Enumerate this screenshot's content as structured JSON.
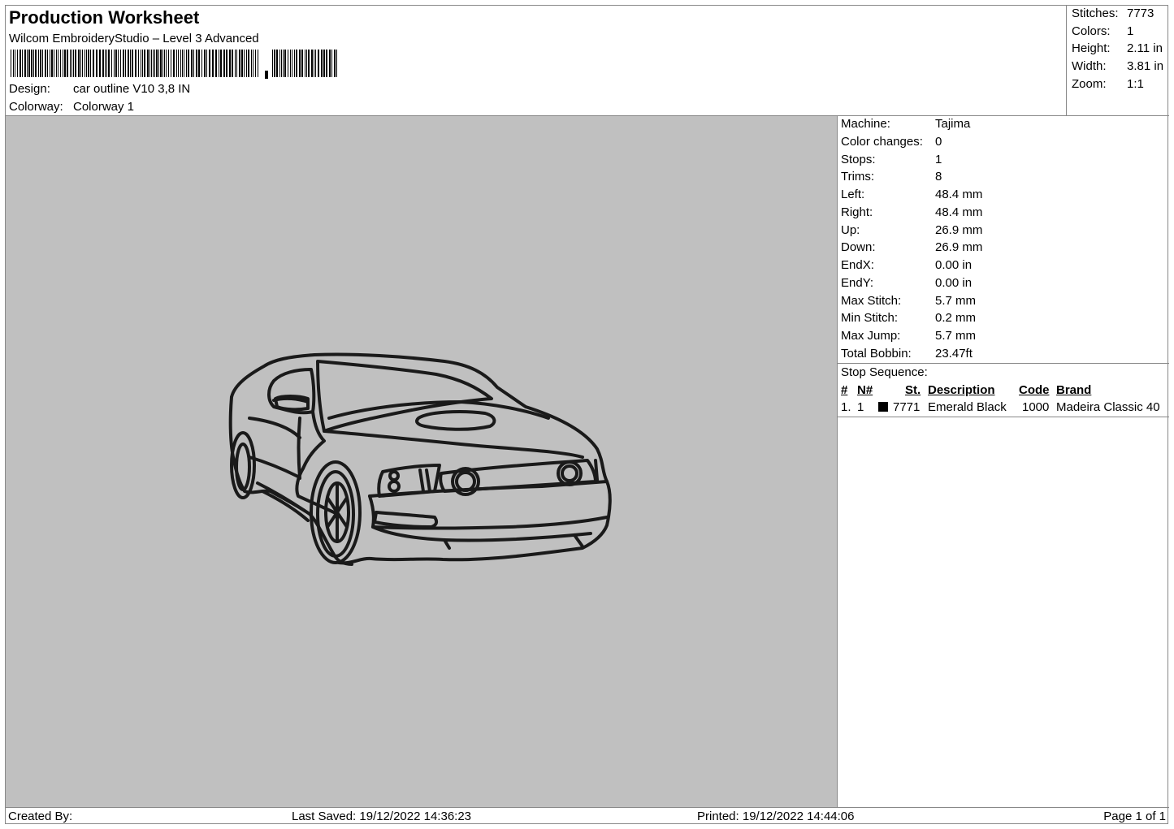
{
  "header": {
    "title": "Production Worksheet",
    "software": "Wilcom EmbroideryStudio – Level 3 Advanced",
    "design_label": "Design:",
    "design_value": "car outline V10 3,8 IN",
    "colorway_label": "Colorway:",
    "colorway_value": "Colorway 1"
  },
  "stats": {
    "stitches_label": "Stitches:",
    "stitches_value": "7773",
    "colors_label": "Colors:",
    "colors_value": "1",
    "height_label": "Height:",
    "height_value": "2.11 in",
    "width_label": "Width:",
    "width_value": "3.81 in",
    "zoom_label": "Zoom:",
    "zoom_value": "1:1"
  },
  "machine_info": [
    {
      "label": "Machine:",
      "value": "Tajima"
    },
    {
      "label": "Color changes:",
      "value": "0"
    },
    {
      "label": "Stops:",
      "value": "1"
    },
    {
      "label": "Trims:",
      "value": "8"
    },
    {
      "label": "Left:",
      "value": "48.4 mm"
    },
    {
      "label": "Right:",
      "value": "48.4 mm"
    },
    {
      "label": "Up:",
      "value": "26.9 mm"
    },
    {
      "label": "Down:",
      "value": "26.9 mm"
    },
    {
      "label": "EndX:",
      "value": "0.00 in"
    },
    {
      "label": "EndY:",
      "value": "0.00 in"
    },
    {
      "label": "Max Stitch:",
      "value": "5.7 mm"
    },
    {
      "label": "Min Stitch:",
      "value": "0.2 mm"
    },
    {
      "label": "Max Jump:",
      "value": "5.7 mm"
    },
    {
      "label": "Total Bobbin:",
      "value": "23.47ft"
    }
  ],
  "stop_sequence": {
    "caption": "Stop Sequence:",
    "headers": {
      "num": "#",
      "n": "N#",
      "st": "St.",
      "description": "Description",
      "code": "Code",
      "brand": "Brand"
    },
    "rows": [
      {
        "num": "1.",
        "n": "1",
        "swatch_color": "#000000",
        "st": "7771",
        "description": "Emerald Black",
        "code": "1000",
        "brand": "Madeira Classic 40"
      }
    ]
  },
  "footer": {
    "created_by": "Created By:",
    "last_saved": "Last Saved: 19/12/2022 14:36:23",
    "printed": "Printed: 19/12/2022 14:44:06",
    "page": "Page 1 of 1"
  },
  "colors": {
    "design_background": "#c0c0c0",
    "thread": "#1a1a1a"
  }
}
